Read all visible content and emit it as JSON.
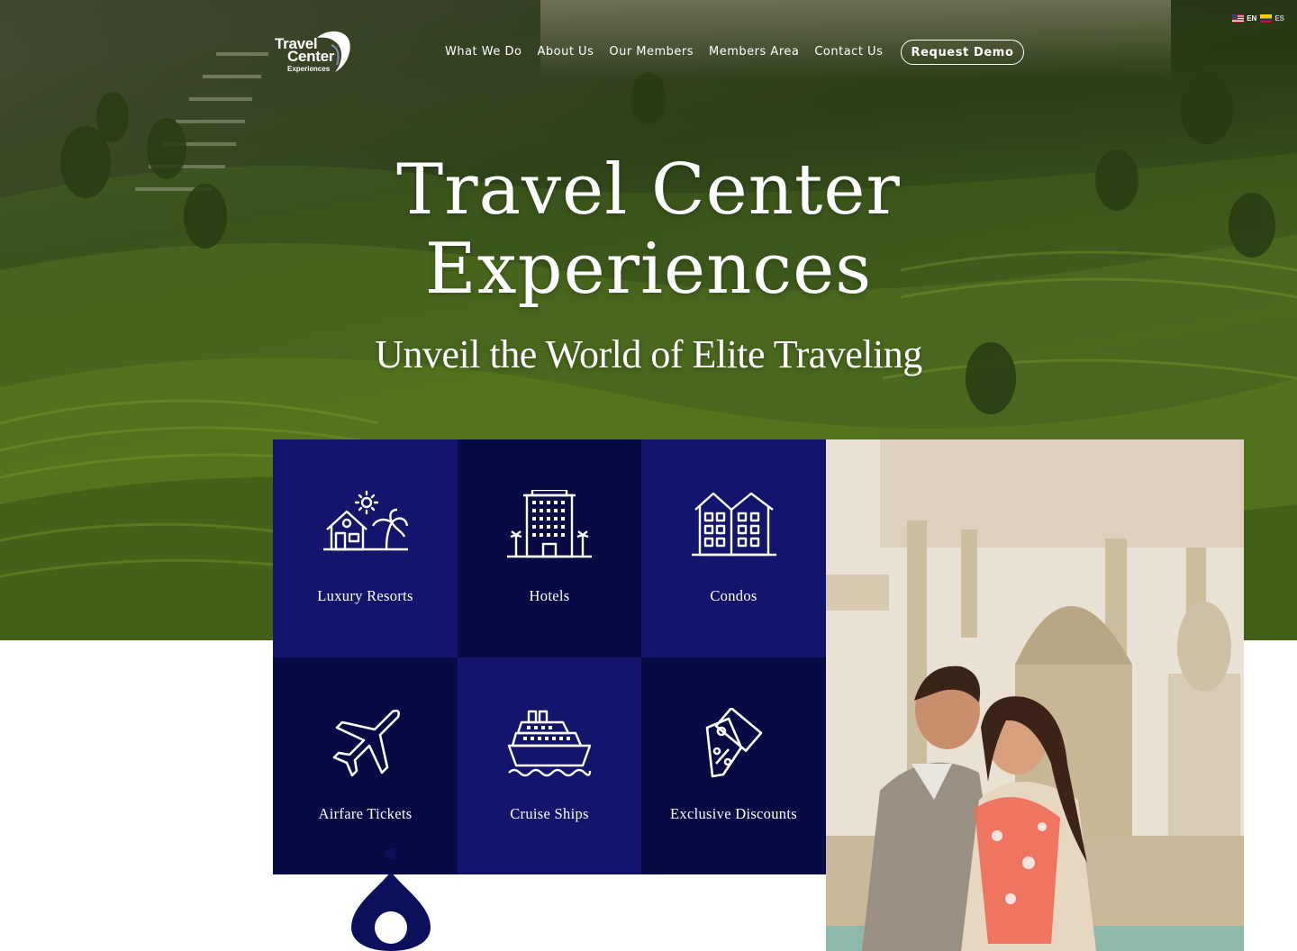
{
  "language": {
    "options": [
      {
        "code": "EN",
        "flag": "us-flag-icon"
      },
      {
        "code": "ES",
        "flag": "colombia-flag-icon"
      }
    ]
  },
  "logo": {
    "line1": "Travel",
    "line2": "Center",
    "line3": "Experiences"
  },
  "nav": {
    "items": [
      "What We Do",
      "About Us",
      "Our Members",
      "Members Area",
      "Contact Us"
    ],
    "cta": "Request Demo"
  },
  "hero": {
    "title_line1": "Travel Center",
    "title_line2": "Experiences",
    "subtitle": "Unveil the World of Elite Traveling"
  },
  "services": [
    {
      "label": "Luxury Resorts",
      "icon": "resort-icon"
    },
    {
      "label": "Hotels",
      "icon": "hotel-icon"
    },
    {
      "label": "Condos",
      "icon": "condo-icon"
    },
    {
      "label": "Airfare Tickets",
      "icon": "airplane-icon"
    },
    {
      "label": "Cruise Ships",
      "icon": "cruise-ship-icon"
    },
    {
      "label": "Exclusive Discounts",
      "icon": "discount-tag-icon"
    }
  ],
  "colors": {
    "tile_light": "#12156b",
    "tile_dark": "#070a45",
    "pin": "#0b0f5c"
  }
}
